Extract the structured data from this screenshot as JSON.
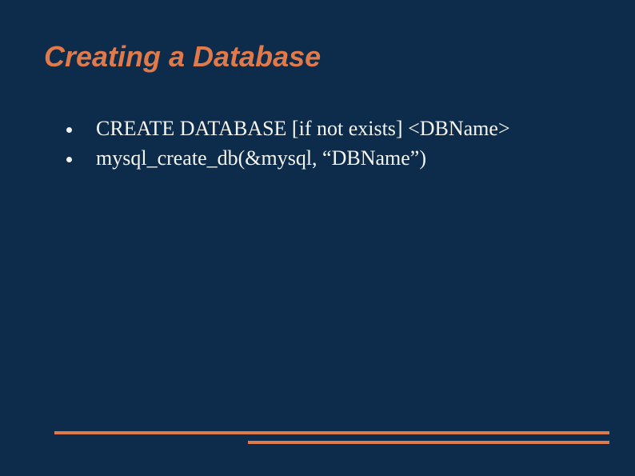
{
  "slide": {
    "title": "Creating a Database",
    "bullets": [
      "CREATE DATABASE [if not exists] <DBName>",
      "mysql_create_db(&mysql, “DBName”)"
    ]
  }
}
